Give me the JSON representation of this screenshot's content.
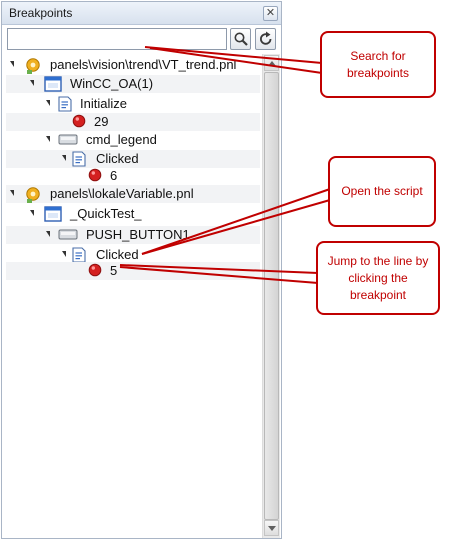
{
  "panel": {
    "title": "Breakpoints",
    "close_glyph": "✕",
    "search_value": ""
  },
  "tree": [
    {
      "label": "panels\\vision\\trend\\VT_trend.pnl",
      "icon": "panel-gear-icon"
    },
    {
      "label": "WinCC_OA(1)",
      "icon": "window-icon"
    },
    {
      "label": "Initialize",
      "icon": "script-icon"
    },
    {
      "label": "29",
      "icon": "breakpoint-icon"
    },
    {
      "label": "cmd_legend",
      "icon": "button-object-icon"
    },
    {
      "label": "Clicked",
      "icon": "script-icon"
    },
    {
      "label": "6",
      "icon": "breakpoint-icon"
    },
    {
      "label": "panels\\lokaleVariable.pnl",
      "icon": "panel-gear-icon"
    },
    {
      "label": "_QuickTest_",
      "icon": "window-icon"
    },
    {
      "label": "PUSH_BUTTON1",
      "icon": "button-object-icon"
    },
    {
      "label": "Clicked",
      "icon": "script-icon"
    },
    {
      "label": "5",
      "icon": "breakpoint-icon"
    }
  ],
  "callouts": {
    "search": "Search for breakpoints",
    "open_script": "Open the script",
    "jump": "Jump to the line by clicking the breakpoint"
  },
  "colors": {
    "callout": "#c00000",
    "breakpoint": "#d42020"
  }
}
